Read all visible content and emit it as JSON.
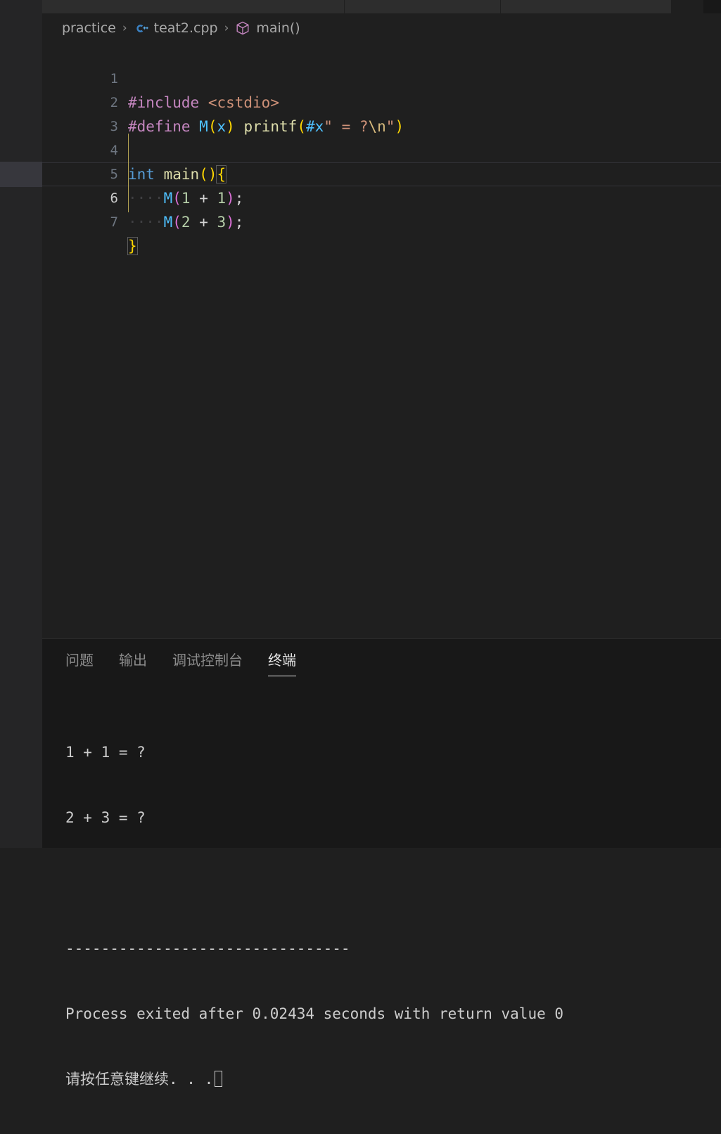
{
  "window": {
    "background": "#1f1f1f",
    "sidebar_background": "#252526",
    "selected_row_background": "#37373d"
  },
  "tabbar": {
    "tabs": [
      {
        "label": ""
      },
      {
        "label": ""
      },
      {
        "label": ""
      },
      {
        "label": ""
      }
    ]
  },
  "breadcrumb": {
    "items": [
      {
        "label": "practice",
        "icon": ""
      },
      {
        "label": "teat2.cpp",
        "icon": "cpp-file-icon"
      },
      {
        "label": "main()",
        "icon": "symbol-method-cube-icon"
      }
    ],
    "separator": "›"
  },
  "editor": {
    "language": "cpp",
    "active_line": 6,
    "lines": [
      {
        "number": "1"
      },
      {
        "number": "2"
      },
      {
        "number": "3"
      },
      {
        "number": "4"
      },
      {
        "number": "5"
      },
      {
        "number": "6"
      },
      {
        "number": "7"
      }
    ],
    "source": {
      "l1_include": "#include",
      "l1_header": "<cstdio>",
      "l2_define": "#define",
      "l2_name": "M",
      "l2_open": "(",
      "l2_param": "x",
      "l2_close": ")",
      "l2_printf": "printf",
      "l2_p_open": "(",
      "l2_hash_x": "#x",
      "l2_quote1": "\"",
      "l2_space_eq": " = ?",
      "l2_esc": "\\n",
      "l2_quote2": "\"",
      "l2_p_close": ")",
      "l4_int": "int",
      "l4_main": "main",
      "l4_paren": "()",
      "l4_brace": "{",
      "l5_indent": "····",
      "l5_macro": "M",
      "l5_open": "(",
      "l5_a": "1",
      "l5_op": " + ",
      "l5_b": "1",
      "l5_close": ")",
      "l5_semi": ";",
      "l6_indent": "····",
      "l6_macro": "M",
      "l6_open": "(",
      "l6_a": "2",
      "l6_op": " + ",
      "l6_b": "3",
      "l6_close": ")",
      "l6_semi": ";",
      "l7_brace": "}"
    }
  },
  "panel": {
    "tabs": [
      {
        "label": "问题",
        "active": false
      },
      {
        "label": "输出",
        "active": false
      },
      {
        "label": "调试控制台",
        "active": false
      },
      {
        "label": "终端",
        "active": true
      }
    ],
    "terminal": {
      "lines": [
        "1 + 1 = ?",
        "2 + 3 = ?",
        "",
        "--------------------------------",
        "Process exited after 0.02434 seconds with return value 0",
        "请按任意键继续. . ."
      ]
    }
  }
}
